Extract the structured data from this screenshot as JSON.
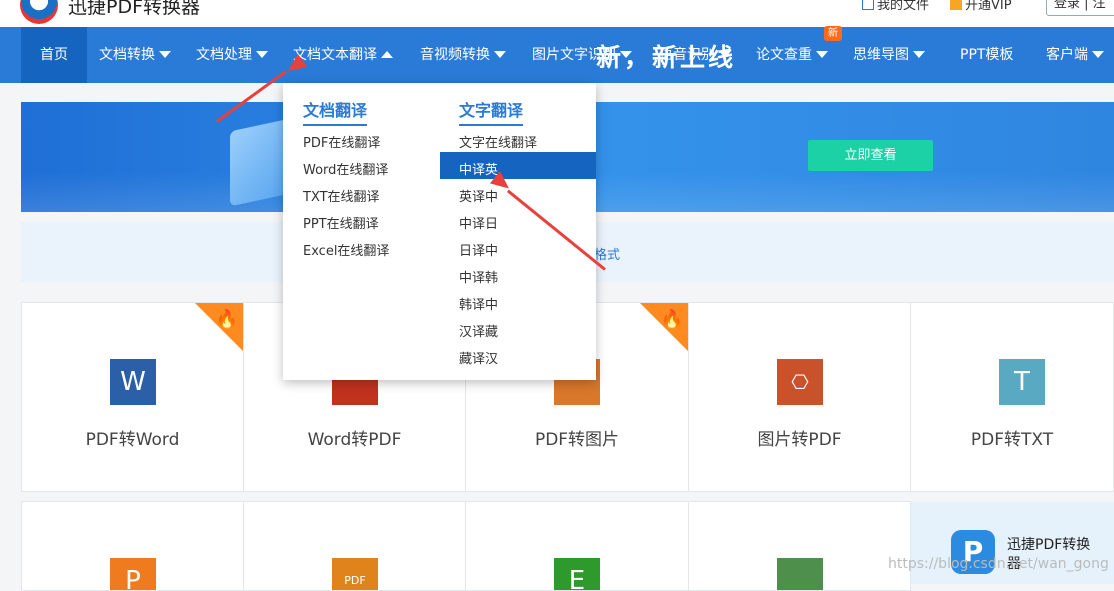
{
  "header": {
    "site_title": "迅捷PDF转换器",
    "my_files": "我的文件",
    "vip": "开通VIP",
    "login": "登录 | 注"
  },
  "nav": {
    "items": [
      {
        "label": "首页"
      },
      {
        "label": "文档转换"
      },
      {
        "label": "文档处理"
      },
      {
        "label": "文档文本翻译"
      },
      {
        "label": "音视频转换"
      },
      {
        "label": "图片文字识别"
      },
      {
        "label": "语音识别"
      },
      {
        "label": "论文查重"
      },
      {
        "label": "思维导图"
      },
      {
        "label": "PPT模板"
      },
      {
        "label": "客户端"
      }
    ],
    "new_badge": "新"
  },
  "dropdown": {
    "col1_title": "文档翻译",
    "col1_items": [
      "PDF在线翻译",
      "Word在线翻译",
      "TXT在线翻译",
      "PPT在线翻译",
      "Excel在线翻译"
    ],
    "col2_title": "文字翻译",
    "col2_items": [
      "文字在线翻译",
      "中译英",
      "英译中",
      "中译日",
      "日译中",
      "中译韩",
      "韩译中",
      "汉译藏",
      "藏译汉"
    ],
    "selected": "中译英"
  },
  "banner": {
    "text": "新，新上线",
    "button": "立即查看"
  },
  "notice": {
    "text": "格式"
  },
  "cards": [
    {
      "label": "PDF转Word",
      "icon_letter": "W",
      "color": "#2b5fa8",
      "hot": true
    },
    {
      "label": "Word转PDF",
      "icon_letter": "",
      "color": "#c0321e",
      "hot": false
    },
    {
      "label": "PDF转图片",
      "icon_letter": "",
      "color": "#d9772b",
      "hot": true
    },
    {
      "label": "图片转PDF",
      "icon_letter": "",
      "color": "#c9522a",
      "hot": false
    },
    {
      "label": "PDF转TXT",
      "icon_letter": "T",
      "color": "#5aa9c2",
      "hot": false
    }
  ],
  "cards_row2": [
    {
      "icon_letter": "P",
      "color": "#f07a1e"
    },
    {
      "icon_letter": "PDF",
      "color": "#e0831b"
    },
    {
      "icon_letter": "E",
      "color": "#2e9a2c"
    },
    {
      "icon_letter": "",
      "color": "#4f8f4c"
    }
  ],
  "widget": {
    "logo": "P",
    "text": "迅捷PDF转换器"
  },
  "watermark": "https://blog.csdn.net/wan_gong"
}
